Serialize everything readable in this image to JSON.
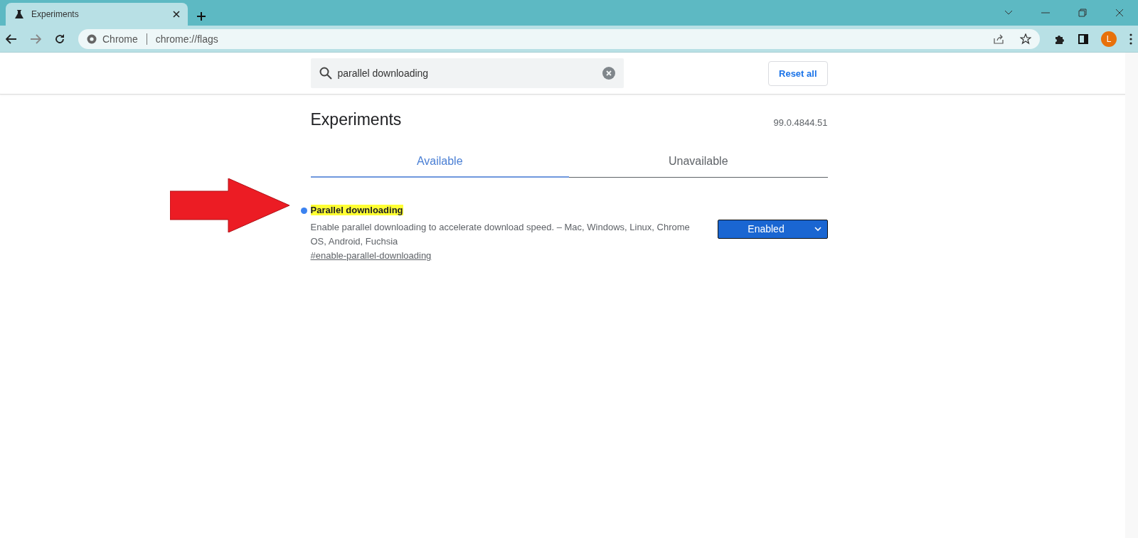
{
  "browser_tab": {
    "title": "Experiments"
  },
  "address_bar": {
    "origin_label": "Chrome",
    "url": "chrome://flags"
  },
  "profile": {
    "initial": "L"
  },
  "search": {
    "value": "parallel downloading"
  },
  "reset_button": "Reset all",
  "heading": "Experiments",
  "version": "99.0.4844.51",
  "tabs": [
    {
      "label": "Available",
      "selected": true
    },
    {
      "label": "Unavailable",
      "selected": false
    }
  ],
  "flags": [
    {
      "title": "Parallel downloading",
      "modified": true,
      "highlighted": true,
      "description": "Enable parallel downloading to accelerate download speed. – Mac, Windows, Linux, Chrome OS, Android, Fuchsia",
      "link": "#enable-parallel-downloading",
      "value": "Enabled"
    }
  ]
}
